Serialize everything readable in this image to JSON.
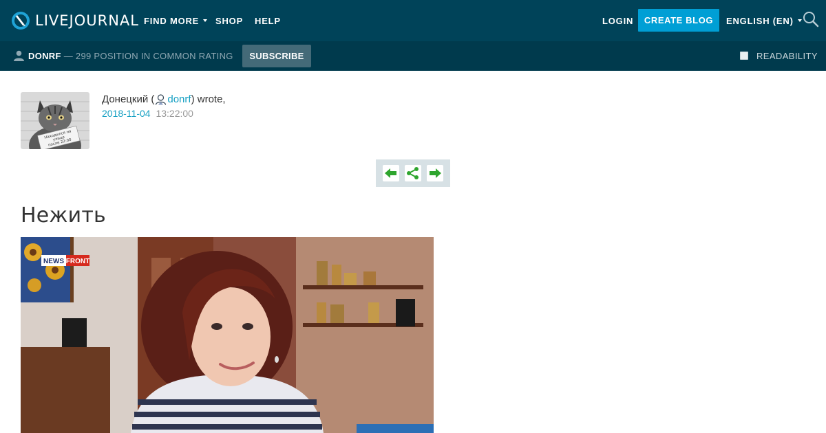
{
  "brand": {
    "name": "LIVEJOURNAL"
  },
  "topnav": {
    "find_more": "FIND MORE",
    "shop": "SHOP",
    "help": "HELP",
    "login": "LOGIN",
    "create_blog": "CREATE BLOG",
    "language": "ENGLISH (EN)"
  },
  "journal": {
    "username": "DONRF",
    "rank_text": "— 299 POSITION IN COMMON RATING",
    "subscribe": "SUBSCRIBE",
    "readability": "READABILITY"
  },
  "post": {
    "author_name": "Донецкий (",
    "author_link": "donrf",
    "wrote": ") wrote,",
    "date": "2018-11-04",
    "time": "13:22:00",
    "title": "Нежить",
    "avatar_sign_text": "Находился на улице после 22:00",
    "image_logo": "NEWS FRONT"
  },
  "colors": {
    "topbar": "#004359",
    "subbar": "#003a4d",
    "accent": "#009fd5",
    "link": "#16a0c3"
  }
}
